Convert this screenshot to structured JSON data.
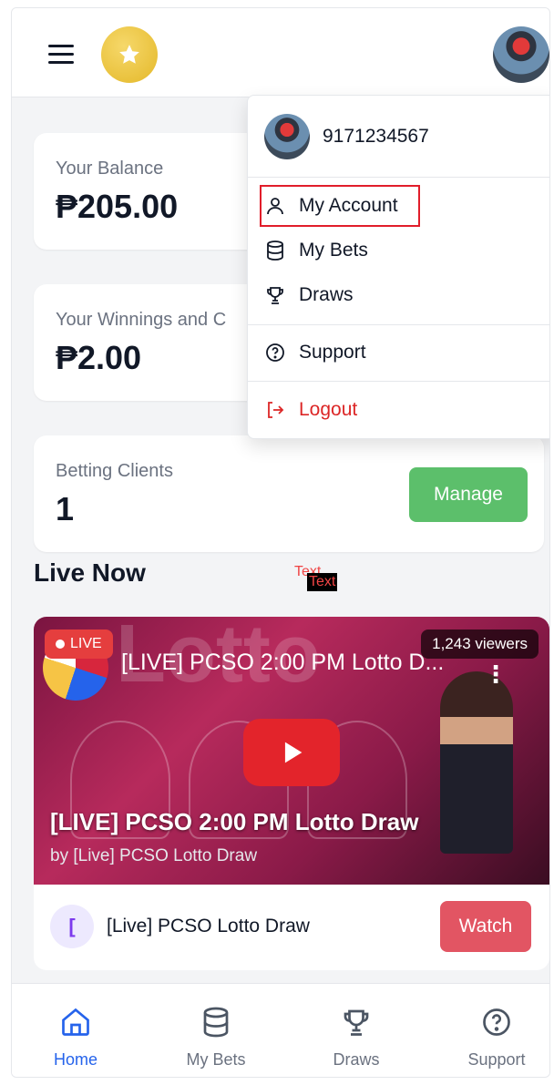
{
  "header": {
    "menu_icon": "hamburger-menu-icon",
    "logo_icon": "star-icon",
    "avatar_icon": "user-avatar"
  },
  "balance": {
    "label": "Your Balance",
    "value": "₱205.00"
  },
  "winnings": {
    "label": "Your Winnings and C",
    "value": "₱2.00"
  },
  "clients": {
    "label": "Betting Clients",
    "value": "1",
    "button": "Manage"
  },
  "live": {
    "heading": "Live Now",
    "overlay_text_1": "Text",
    "overlay_text_2": "Text",
    "video": {
      "badge": "LIVE",
      "viewers": "1,243 viewers",
      "top_title": "[LIVE] PCSO 2:00 PM Lotto D...",
      "thumb_text": "Lotto",
      "title": "[LIVE] PCSO 2:00 PM Lotto Draw",
      "by": "by [Live] PCSO Lotto Draw",
      "channel_initial": "[",
      "channel_name": "[Live] PCSO Lotto Draw",
      "watch_label": "Watch"
    }
  },
  "dropdown": {
    "phone": "9171234567",
    "items": [
      {
        "label": "My Account",
        "icon": "user-icon"
      },
      {
        "label": "My Bets",
        "icon": "database-icon"
      },
      {
        "label": "Draws",
        "icon": "trophy-icon"
      },
      {
        "label": "Support",
        "icon": "help-circle-icon"
      },
      {
        "label": "Logout",
        "icon": "logout-icon"
      }
    ]
  },
  "bottom_nav": [
    {
      "label": "Home",
      "icon": "home-icon",
      "active": true
    },
    {
      "label": "My Bets",
      "icon": "database-icon",
      "active": false
    },
    {
      "label": "Draws",
      "icon": "trophy-icon",
      "active": false
    },
    {
      "label": "Support",
      "icon": "help-circle-icon",
      "active": false
    }
  ],
  "colors": {
    "accent_blue": "#2563eb",
    "manage_green": "#5cbf6b",
    "watch_red": "#e25563",
    "logout_red": "#dc2626",
    "highlight_red": "#e11d2a"
  }
}
